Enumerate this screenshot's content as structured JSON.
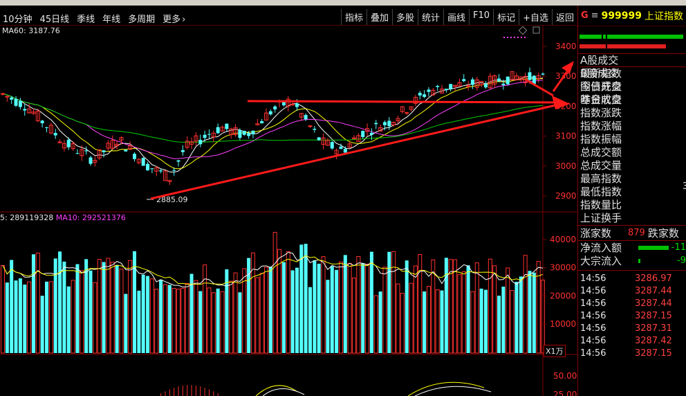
{
  "toolbar": {
    "periods": [
      "10分钟",
      "45日线",
      "季线",
      "年线",
      "多周期",
      "更多"
    ],
    "tools": [
      "指标",
      "叠加",
      "多股",
      "统计",
      "画线",
      "F10",
      "标记",
      "+自选",
      "返回"
    ]
  },
  "main_chart": {
    "ma60_label": "MA60: 3187.76",
    "price_axis": [
      "3400",
      "3300",
      "3200",
      "3100",
      "3000",
      "2900"
    ],
    "low_annotation": "2885.09",
    "vol_ma5_label": "5: 289119328",
    "vol_ma10_label": "MA10: 292521376",
    "volume_axis": [
      "40000",
      "30000",
      "20000",
      "10000"
    ],
    "volume_unit": "X1万",
    "indicator_axis": [
      "50.00",
      "25.00"
    ]
  },
  "right_panel": {
    "marker": "G",
    "menu_icon": "menu-icon",
    "code": "999999",
    "name": "上证指数",
    "labels_group1": [
      "A股成交",
      "B股成交",
      "国债成交",
      "基金成交"
    ],
    "labels_group2": [
      "最新指数",
      "今日开盘",
      "昨日收盘",
      "指数涨跌",
      "指数涨幅",
      "指数振幅",
      "总成交额",
      "总成交量",
      "最高指数",
      "最低指数",
      "指数量比",
      "上证换手"
    ],
    "rise_label": "涨家数",
    "rise_value": "879",
    "fall_label": "跌家数",
    "net_inflow_label": "净流入额",
    "net_inflow_value": "-11",
    "block_inflow_label": "大宗流入",
    "block_inflow_value": "-9",
    "side_digit": "3",
    "ticks": [
      {
        "time": "14:56",
        "price": "3286.97"
      },
      {
        "time": "14:56",
        "price": "3287.44"
      },
      {
        "time": "14:56",
        "price": "3287.44"
      },
      {
        "time": "14:56",
        "price": "3287.15"
      },
      {
        "time": "14:56",
        "price": "3287.31"
      },
      {
        "time": "14:56",
        "price": "3287.42"
      },
      {
        "time": "14:56",
        "price": "3287.15"
      }
    ]
  },
  "colors": {
    "up": "#ff3030",
    "down": "#54ffff",
    "ma5": "#ffffff",
    "ma10": "#ffff00",
    "ma20": "#ff40ff",
    "ma60": "#00d000",
    "grid": "#800000"
  }
}
